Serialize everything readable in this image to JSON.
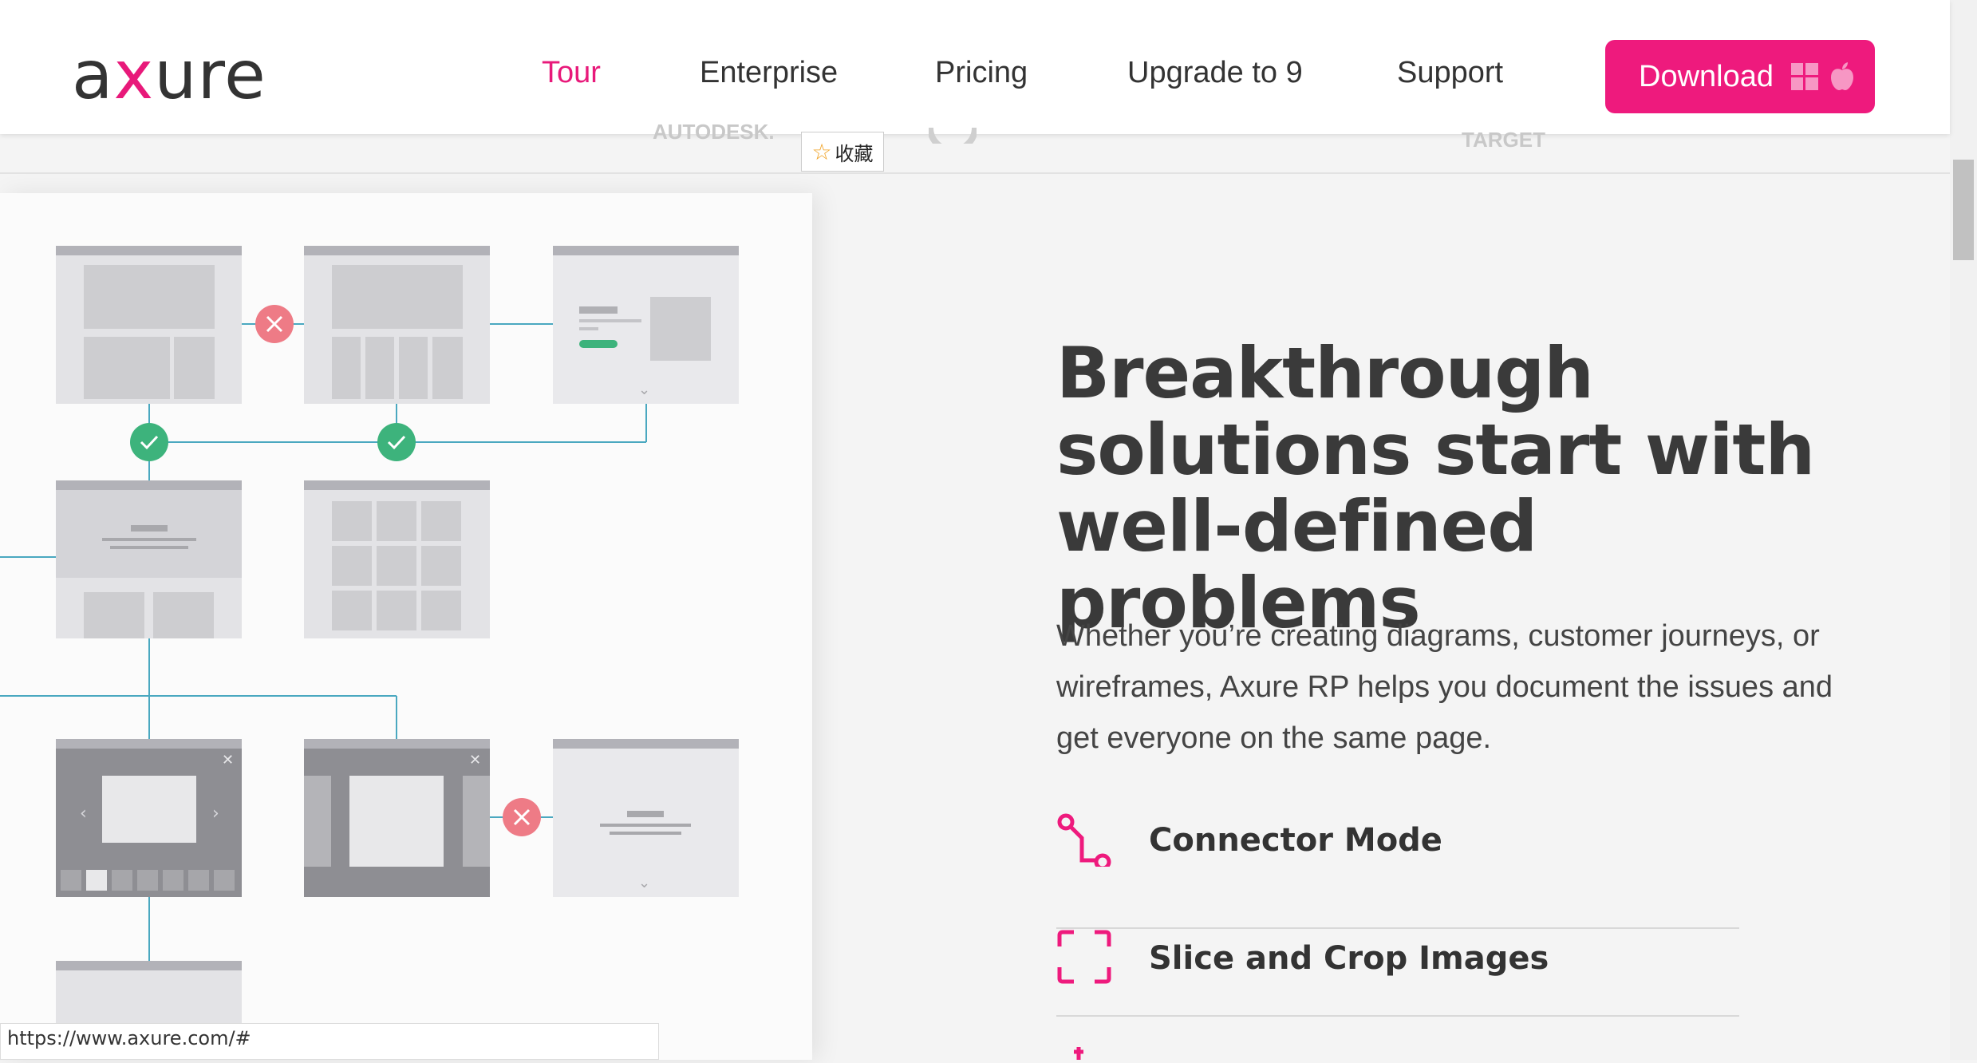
{
  "header": {
    "logo_text_a": "a",
    "logo_text_x": "x",
    "logo_text_rest": "ure",
    "nav": [
      {
        "label": "Tour",
        "active": true
      },
      {
        "label": "Enterprise",
        "active": false
      },
      {
        "label": "Pricing",
        "active": false
      },
      {
        "label": "Upgrade to 9",
        "active": false
      },
      {
        "label": "Support",
        "active": false
      }
    ],
    "download_label": "Download",
    "download_icons": [
      "windows-icon",
      "apple-icon"
    ]
  },
  "customer_logos": [
    "AUTODESK.",
    "TARGET"
  ],
  "favorite_button": {
    "icon": "star-icon",
    "label": "收藏"
  },
  "hero": {
    "heading_lines": [
      "Breakthrough",
      "solutions start with",
      "well-defined problems"
    ],
    "paragraph": "Whether you’re creating diagrams, customer journeys, or wireframes, Axure RP helps you document the issues and get everyone on the same page."
  },
  "features": [
    {
      "label": "Connector Mode",
      "icon": "connector-icon"
    },
    {
      "label": "Slice and Crop Images",
      "icon": "crop-icon"
    }
  ],
  "status_url": "https://www.axure.com/#",
  "colors": {
    "accent": "#ee1a7d",
    "connector": "#4aa8c0",
    "ok": "#3db37c",
    "error": "#ee7b86"
  }
}
